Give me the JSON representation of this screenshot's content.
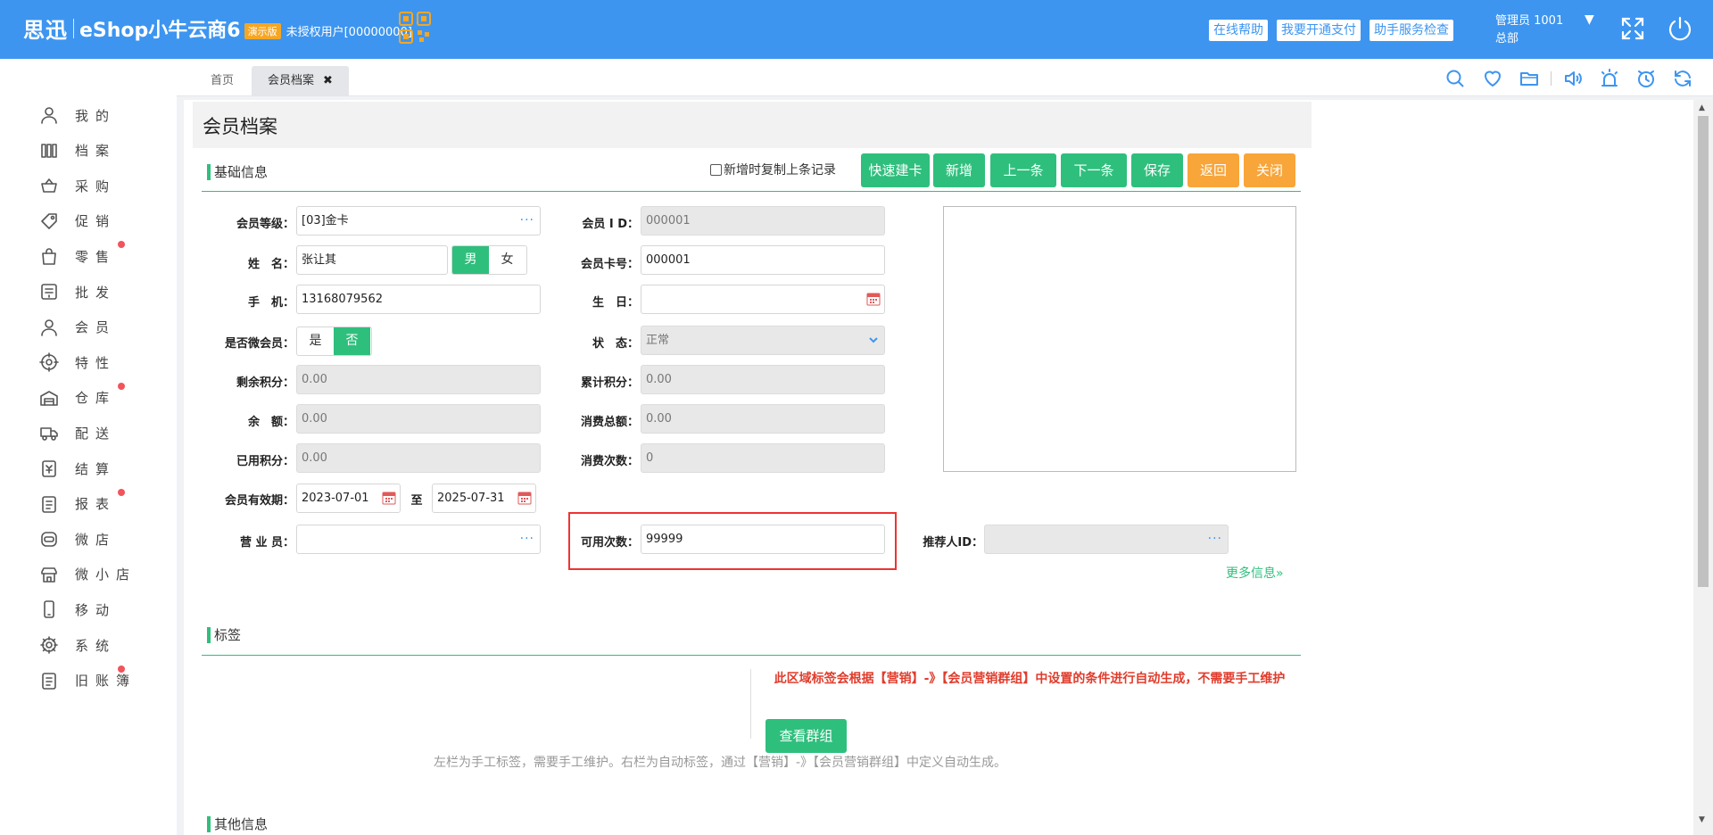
{
  "topbar": {
    "logo_cn": "思迅",
    "product": "eShop小牛云商6",
    "edition_badge": "演示版",
    "unauth_user": "未授权用户[00000000]",
    "links": [
      "在线帮助",
      "我要开通支付",
      "助手服务检查"
    ],
    "user_line1": "管理员 1001",
    "user_line2": "总部",
    "caret": "▼"
  },
  "sidebar": {
    "items": [
      {
        "label": "我的",
        "icon": "user-icon",
        "badge": false
      },
      {
        "label": "档案",
        "icon": "archive-icon",
        "badge": false
      },
      {
        "label": "采购",
        "icon": "basket-icon",
        "badge": false
      },
      {
        "label": "促销",
        "icon": "tag-icon",
        "badge": false
      },
      {
        "label": "零售",
        "icon": "bag-icon",
        "badge": true
      },
      {
        "label": "批发",
        "icon": "invoice-icon",
        "badge": false
      },
      {
        "label": "会员",
        "icon": "member-icon",
        "badge": false
      },
      {
        "label": "特性",
        "icon": "target-icon",
        "badge": false
      },
      {
        "label": "仓库",
        "icon": "warehouse-icon",
        "badge": true
      },
      {
        "label": "配送",
        "icon": "truck-icon",
        "badge": false
      },
      {
        "label": "结算",
        "icon": "settle-icon",
        "badge": false
      },
      {
        "label": "报表",
        "icon": "report-icon",
        "badge": true
      },
      {
        "label": "微店",
        "icon": "wechat-store-icon",
        "badge": false
      },
      {
        "label": "微小店",
        "icon": "mini-store-icon",
        "badge": false
      },
      {
        "label": "移动",
        "icon": "mobile-icon",
        "badge": false
      },
      {
        "label": "系统",
        "icon": "gear-icon",
        "badge": false
      },
      {
        "label": "旧账簿",
        "icon": "ledger-icon",
        "badge": true
      }
    ]
  },
  "tabs": {
    "home": "首页",
    "active": "会员档案",
    "close": "✖"
  },
  "page": {
    "title": "会员档案"
  },
  "basic": {
    "section_title": "基础信息",
    "copy_checkbox": "新增时复制上条记录",
    "buttons": {
      "quick_card": "快速建卡",
      "add": "新增",
      "prev": "上一条",
      "next": "下一条",
      "save": "保存",
      "back": "返回",
      "close": "关闭"
    },
    "labels": {
      "level": "会员等级：",
      "name": "姓　名：",
      "phone": "手　机：",
      "is_wechat": "是否微会员：",
      "remain_points": "剩余积分：",
      "balance": "余　额：",
      "used_points": "已用积分：",
      "valid_period": "会员有效期：",
      "to": "至",
      "salesperson": "营 业 员：",
      "member_id": "会员 I D：",
      "card_no": "会员卡号：",
      "birthday": "生　日：",
      "status": "状　态：",
      "total_points": "累计积分：",
      "total_spend": "消费总额：",
      "spend_count": "消费次数：",
      "available_count": "可用次数：",
      "referrer": "推荐人ID："
    },
    "values": {
      "level": "[03]金卡",
      "name": "张让其",
      "phone": "13168079562",
      "remain_points": "0.00",
      "balance": "0.00",
      "used_points": "0.00",
      "valid_from": "2023-07-01",
      "valid_to": "2025-07-31",
      "salesperson": "",
      "member_id": "000001",
      "card_no": "000001",
      "birthday": "",
      "status": "正常",
      "total_points": "0.00",
      "total_spend": "0.00",
      "spend_count": "0",
      "available_count": "99999",
      "referrer": ""
    },
    "gender": {
      "male": "男",
      "female": "女",
      "selected": "男"
    },
    "wechat": {
      "yes": "是",
      "no": "否",
      "selected": "否"
    },
    "ellipsis": "···",
    "more_info": "更多信息»"
  },
  "tags": {
    "section_title": "标签",
    "note": "此区域标签会根据【营销】-》【会员营销群组】中设置的条件进行自动生成，不需要手工维护",
    "view_group_button": "查看群组",
    "hint": "左栏为手工标签，需要手工维护。右栏为自动标签，通过【营销】-》【会员营销群组】中定义自动生成。"
  },
  "other": {
    "section_title": "其他信息"
  },
  "colors": {
    "topbar": "#3d95f0",
    "green": "#2fbf7d",
    "orange": "#f8a539",
    "highlight_border": "#ee3333",
    "badge_dot": "#f2545b"
  }
}
